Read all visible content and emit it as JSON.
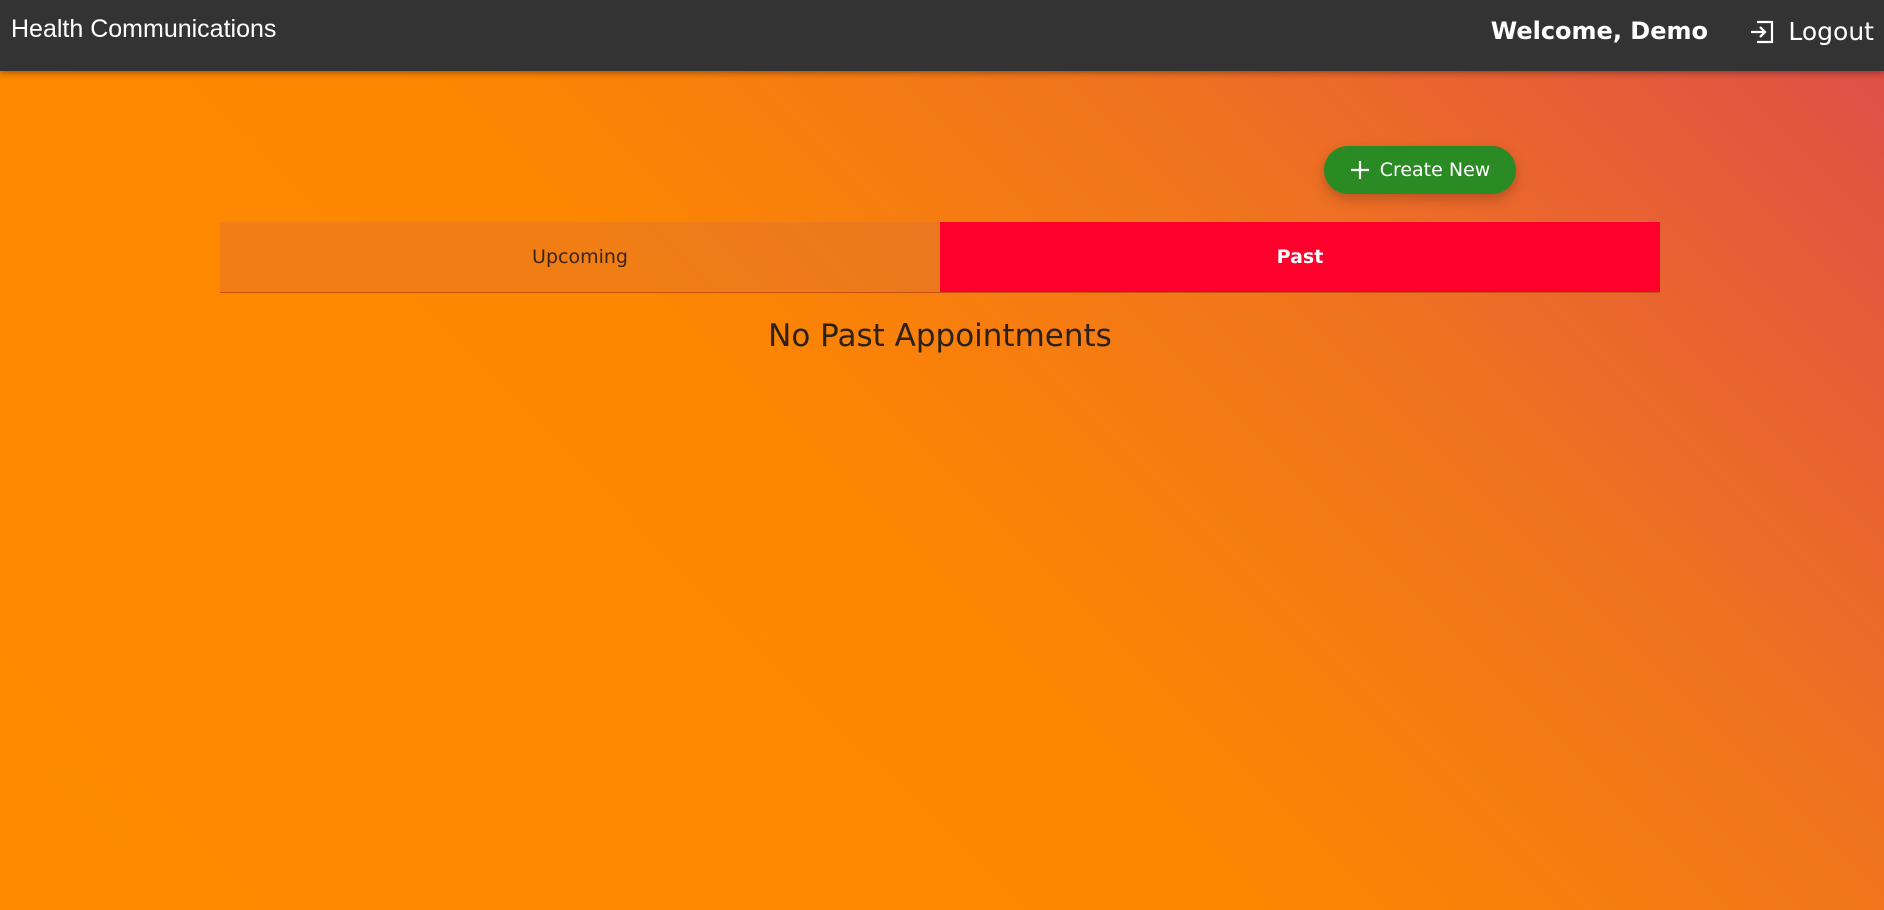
{
  "header": {
    "app_title": "Health Communications",
    "welcome_text": "Welcome, Demo",
    "logout_label": "Logout",
    "logout_icon": "logout-icon"
  },
  "actions": {
    "create_label": "Create New",
    "create_icon": "plus-icon",
    "create_color": "#2a8a24"
  },
  "tabs": [
    {
      "label": "Upcoming",
      "active": false
    },
    {
      "label": "Past",
      "active": true,
      "color": "#ff002d"
    }
  ],
  "content": {
    "empty_message": "No Past Appointments"
  }
}
